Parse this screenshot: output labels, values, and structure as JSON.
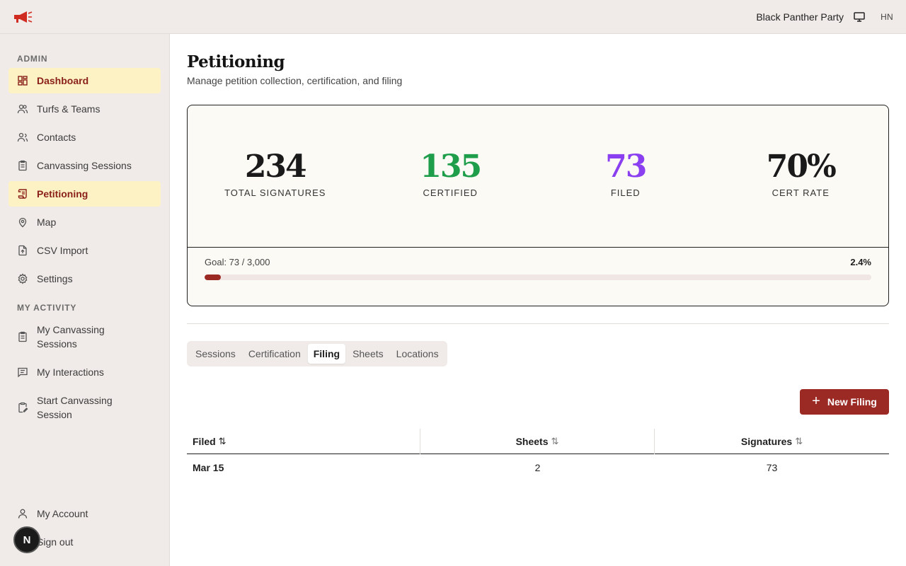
{
  "topbar": {
    "org_name": "Black Panther Party",
    "user_initials": "HN",
    "icons": {
      "logo": "megaphone-logo",
      "display": "monitor-icon"
    }
  },
  "sidebar": {
    "admin_label": "ADMIN",
    "admin_items": [
      {
        "label": "Dashboard",
        "icon": "dashboard-icon",
        "active": true
      },
      {
        "label": "Turfs & Teams",
        "icon": "users-icon",
        "active": false
      },
      {
        "label": "Contacts",
        "icon": "contacts-icon",
        "active": false
      },
      {
        "label": "Canvassing Sessions",
        "icon": "clipboard-icon",
        "active": false
      },
      {
        "label": "Petitioning",
        "icon": "scroll-icon",
        "active": true
      },
      {
        "label": "Map",
        "icon": "map-pin-icon",
        "active": false
      },
      {
        "label": "CSV Import",
        "icon": "file-import-icon",
        "active": false
      },
      {
        "label": "Settings",
        "icon": "gear-icon",
        "active": false
      }
    ],
    "activity_label": "MY ACTIVITY",
    "activity_items": [
      {
        "label": "My Canvassing Sessions",
        "icon": "clipboard-list-icon"
      },
      {
        "label": "My Interactions",
        "icon": "message-icon"
      },
      {
        "label": "Start Canvassing Session",
        "icon": "clipboard-pen-icon"
      }
    ],
    "footer_items": [
      {
        "label": "My Account",
        "icon": "user-icon"
      },
      {
        "label": "Sign out",
        "icon": "sign-out-icon"
      }
    ],
    "dev_badge": "N"
  },
  "page": {
    "title": "Petitioning",
    "subtitle": "Manage petition collection, certification, and filing"
  },
  "stats": [
    {
      "value": "234",
      "label": "TOTAL SIGNATURES",
      "color": "#1a1a1a"
    },
    {
      "value": "135",
      "label": "CERTIFIED",
      "color": "#1e9e4a"
    },
    {
      "value": "73",
      "label": "FILED",
      "color": "#8a3ff0"
    },
    {
      "value": "70%",
      "label": "CERT RATE",
      "color": "#1a1a1a"
    }
  ],
  "goal": {
    "label": "Goal: 73 / 3,000",
    "percent_label": "2.4%",
    "progress": 0.024,
    "fill_color": "#9b2a24"
  },
  "tabs": [
    {
      "label": "Sessions",
      "active": false
    },
    {
      "label": "Certification",
      "active": false
    },
    {
      "label": "Filing",
      "active": true
    },
    {
      "label": "Sheets",
      "active": false
    },
    {
      "label": "Locations",
      "active": false
    }
  ],
  "new_filing_button": "New Filing",
  "table": {
    "headers": [
      {
        "label": "Filed",
        "sort": "⇅"
      },
      {
        "label": "Sheets",
        "sort": "⇅"
      },
      {
        "label": "Signatures",
        "sort": "⇅"
      }
    ],
    "rows": [
      [
        "Mar 15",
        "2",
        "73"
      ]
    ]
  },
  "colors": {
    "accent": "#9b2a24",
    "active_bg": "#fdf2c4",
    "active_text": "#8a1f1a",
    "sidebar_bg": "#f0ebe8"
  }
}
